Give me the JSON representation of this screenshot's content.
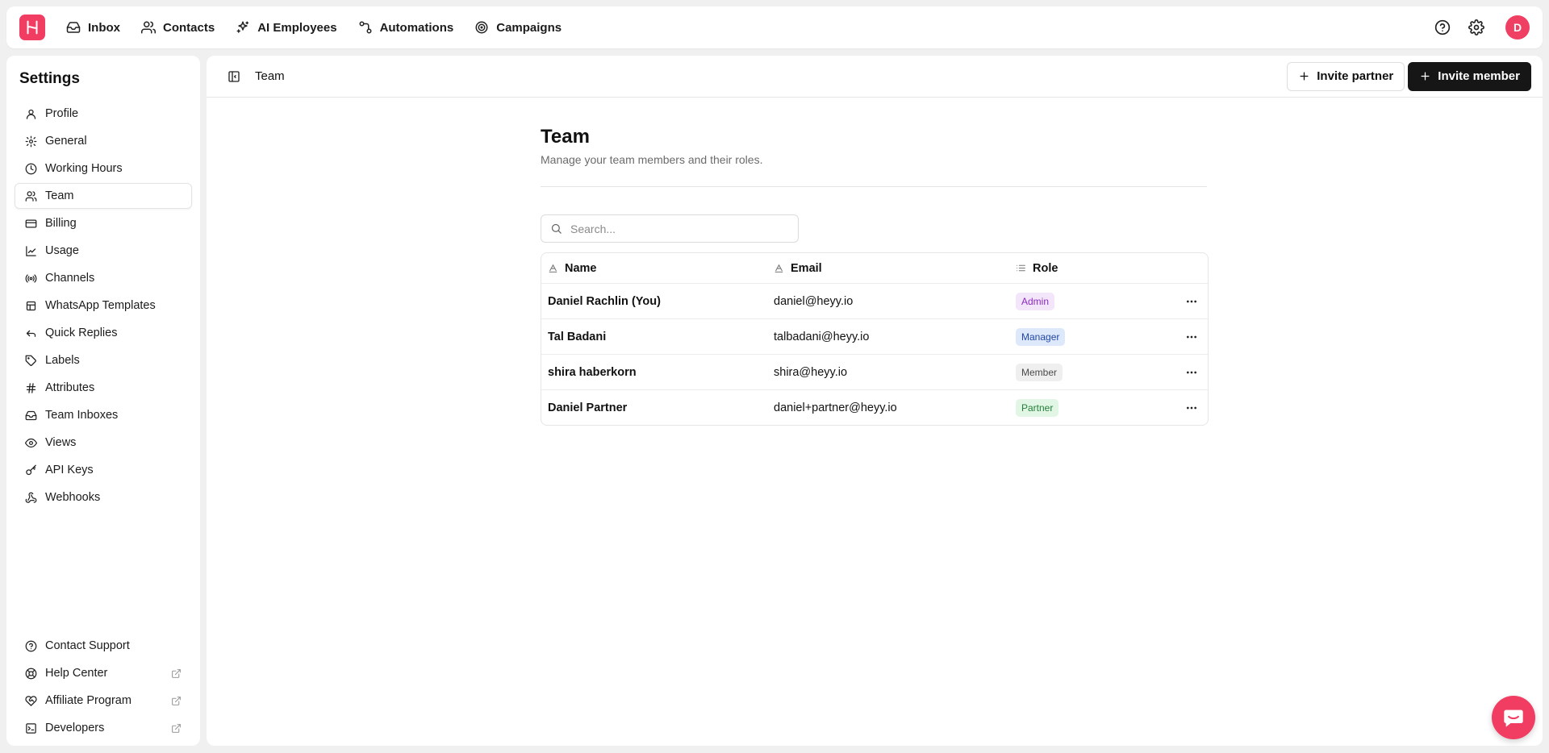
{
  "colors": {
    "brand": "#f23d63",
    "dark_button": "#161616"
  },
  "topnav": {
    "items": [
      {
        "label": "Inbox",
        "icon": "inbox-icon"
      },
      {
        "label": "Contacts",
        "icon": "users-icon"
      },
      {
        "label": "AI Employees",
        "icon": "sparkles-icon"
      },
      {
        "label": "Automations",
        "icon": "workflow-icon"
      },
      {
        "label": "Campaigns",
        "icon": "target-icon"
      }
    ],
    "avatar_initial": "D"
  },
  "sidebar": {
    "title": "Settings",
    "items": [
      {
        "label": "Profile"
      },
      {
        "label": "General"
      },
      {
        "label": "Working Hours"
      },
      {
        "label": "Team",
        "active": true
      },
      {
        "label": "Billing"
      },
      {
        "label": "Usage"
      },
      {
        "label": "Channels"
      },
      {
        "label": "WhatsApp Templates"
      },
      {
        "label": "Quick Replies"
      },
      {
        "label": "Labels"
      },
      {
        "label": "Attributes"
      },
      {
        "label": "Team Inboxes"
      },
      {
        "label": "Views"
      },
      {
        "label": "API Keys"
      },
      {
        "label": "Webhooks"
      }
    ],
    "bottom_items": [
      {
        "label": "Contact Support"
      },
      {
        "label": "Help Center"
      },
      {
        "label": "Affiliate Program"
      },
      {
        "label": "Developers"
      }
    ]
  },
  "header": {
    "breadcrumb": "Team",
    "invite_partner_label": "Invite partner",
    "invite_member_label": "Invite member"
  },
  "main": {
    "title": "Team",
    "subtitle": "Manage your team members and their roles.",
    "search_placeholder": "Search...",
    "columns": {
      "name": "Name",
      "email": "Email",
      "role": "Role"
    },
    "members": [
      {
        "name": "Daniel Rachlin (You)",
        "email": "daniel@heyy.io",
        "role": "Admin"
      },
      {
        "name": "Tal Badani",
        "email": "talbadani@heyy.io",
        "role": "Manager"
      },
      {
        "name": "shira haberkorn",
        "email": "shira@heyy.io",
        "role": "Member"
      },
      {
        "name": "Daniel Partner",
        "email": "daniel+partner@heyy.io",
        "role": "Partner"
      }
    ]
  }
}
